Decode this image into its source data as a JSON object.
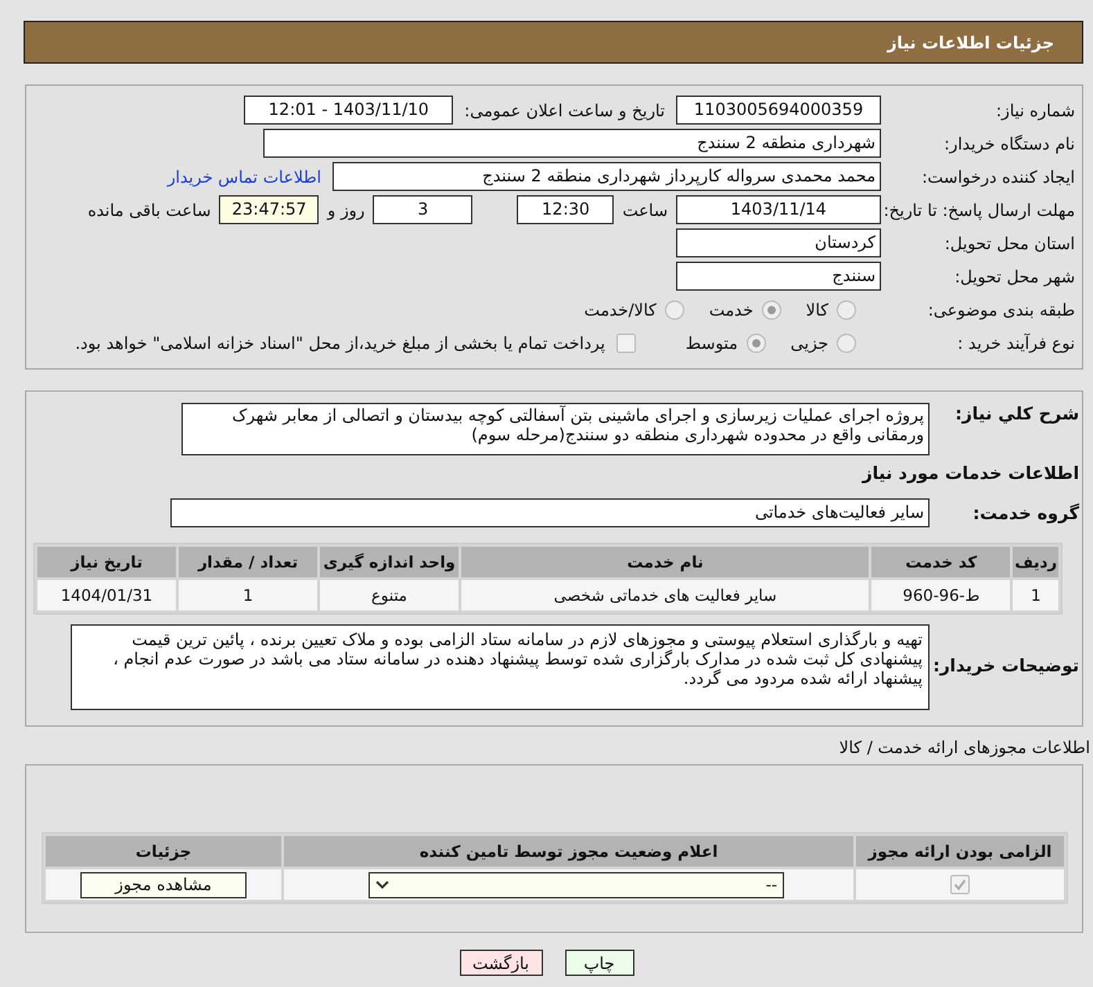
{
  "header": {
    "title": "جزئیات اطلاعات نیاز"
  },
  "need_number": {
    "label": "شماره نیاز:",
    "value": "1103005694000359"
  },
  "announce": {
    "label": "تاریخ و ساعت اعلان عمومی:",
    "value": "1403/11/10 - 12:01"
  },
  "buyer": {
    "label": "نام دستگاه خریدار:",
    "value": "شهرداری منطقه 2 سنندج"
  },
  "requester": {
    "label": "ایجاد کننده درخواست:",
    "value": "محمد محمدی سرواله کارپرداز شهرداری منطقه 2 سنندج",
    "link": "اطلاعات تماس خریدار"
  },
  "deadline": {
    "label": "مهلت ارسال پاسخ: تا تاریخ:",
    "date": "1403/11/14",
    "time_label": "ساعت",
    "time": "12:30",
    "days": "3",
    "days_label": "روز و",
    "remaining": "23:47:57",
    "remaining_label": "ساعت باقی مانده"
  },
  "province": {
    "label": "استان محل تحویل:",
    "value": "کردستان"
  },
  "city": {
    "label": "شهر محل تحویل:",
    "value": "سنندج"
  },
  "category": {
    "label": "طبقه بندی موضوعی:",
    "options": [
      {
        "label": "کالا",
        "selected": false
      },
      {
        "label": "خدمت",
        "selected": true
      },
      {
        "label": "کالا/خدمت",
        "selected": false
      }
    ]
  },
  "process": {
    "label": "نوع فرآیند خرید :",
    "options": [
      {
        "label": "جزیی",
        "selected": false
      },
      {
        "label": "متوسط",
        "selected": true
      }
    ],
    "payment": {
      "checked": false,
      "text": "پرداخت تمام یا بخشی از مبلغ خرید،از محل \"اسناد خزانه اسلامی\" خواهد بود."
    }
  },
  "description": {
    "label": "شرح کلي نیاز:",
    "text": "پروژه اجرای عملیات زیرسازی و اجرای ماشینی بتن آسفالتی کوچه بیدستان و اتصالی از معابر شهرک ورمقانی واقع در محدوده شهرداری منطقه دو سنندج(مرحله سوم)"
  },
  "services_title": "اطلاعات خدمات مورد نیاز",
  "service_group": {
    "label": "گروه خدمت:",
    "value": "سایر فعالیت‌های خدماتی"
  },
  "services_table": {
    "columns": [
      "ردیف",
      "کد خدمت",
      "نام خدمت",
      "واحد اندازه گیری",
      "تعداد / مقدار",
      "تاریخ نیاز"
    ],
    "rows": [
      [
        "1",
        "ط-96-960",
        "سایر فعالیت های خدماتی شخصی",
        "متنوع",
        "1",
        "1404/01/31"
      ]
    ]
  },
  "buyer_notes": {
    "label": "توضیحات خریدار:",
    "text": "تهیه و بارگذاری استعلام پیوستی و مجوزهای لازم در سامانه ستاد الزامی بوده و ملاک تعیین برنده ، پائین ترین قیمت پیشنهادی کل ثبت شده در مدارک بارگزاری شده توسط پیشنهاد دهنده در سامانه ستاد می باشد در صورت عدم انجام ، پیشنهاد ارائه شده مردود می گردد."
  },
  "licenses": {
    "title": "اطلاعات مجوزهای ارائه خدمت / کالا",
    "columns": [
      "الزامی بودن ارائه مجوز",
      "اعلام وضعیت مجوز توسط تامین کننده",
      "جزئیات"
    ],
    "rows": [
      {
        "required": true,
        "status": "--",
        "action": "مشاهده مجوز"
      }
    ]
  },
  "buttons": [
    {
      "label": "چاپ",
      "kind": "print"
    },
    {
      "label": "بازگشت",
      "kind": "back"
    }
  ]
}
